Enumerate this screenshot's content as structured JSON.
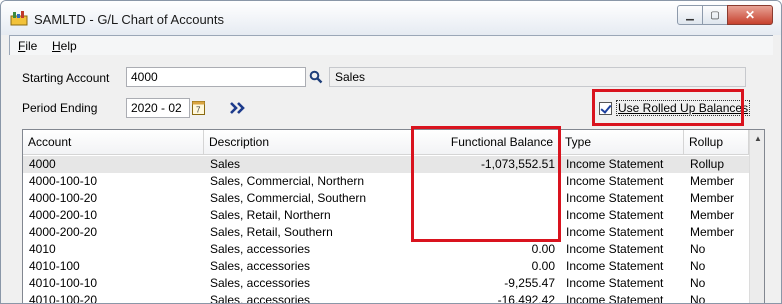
{
  "window": {
    "title": "SAMLTD - G/L Chart of Accounts",
    "minimize_glyph": "▁",
    "maximize_glyph": "▢",
    "close_glyph": "✕"
  },
  "menu": {
    "file": {
      "accel": "F",
      "rest": "ile"
    },
    "help": {
      "accel": "H",
      "rest": "elp"
    }
  },
  "form": {
    "starting_account_label": "Starting Account",
    "starting_account_value": "4000",
    "account_description": "Sales",
    "period_ending_label": "Period Ending",
    "period_ending_value": "2020 - 02",
    "rolled_up_label": "Use Rolled Up Balances",
    "rolled_up_checked": true
  },
  "icons": {
    "app": "app-icon",
    "finder": "search-icon",
    "calendar": "calendar-icon",
    "next": "double-chevron-right-icon"
  },
  "colors": {
    "highlight": "#d9131e",
    "selected_row": "#e6e6e6"
  },
  "grid": {
    "columns": [
      "Account",
      "Description",
      "Functional Balance",
      "Type",
      "Rollup"
    ],
    "rows": [
      [
        "4000",
        "Sales",
        "-1,073,552.51",
        "Income Statement",
        "Rollup"
      ],
      [
        "4000-100-10",
        "Sales, Commercial, Northern",
        "",
        "Income Statement",
        "Member"
      ],
      [
        "4000-100-20",
        "Sales, Commercial, Southern",
        "",
        "Income Statement",
        "Member"
      ],
      [
        "4000-200-10",
        "Sales, Retail, Northern",
        "",
        "Income Statement",
        "Member"
      ],
      [
        "4000-200-20",
        "Sales, Retail, Southern",
        "",
        "Income Statement",
        "Member"
      ],
      [
        "4010",
        "Sales, accessories",
        "0.00",
        "Income Statement",
        "No"
      ],
      [
        "4010-100",
        "Sales, accessories",
        "0.00",
        "Income Statement",
        "No"
      ],
      [
        "4010-100-10",
        "Sales, accessories",
        "-9,255.47",
        "Income Statement",
        "No"
      ],
      [
        "4010-100-20",
        "Sales, accessories",
        "-16,492.42",
        "Income Statement",
        "No"
      ]
    ],
    "selected_row": 0
  }
}
